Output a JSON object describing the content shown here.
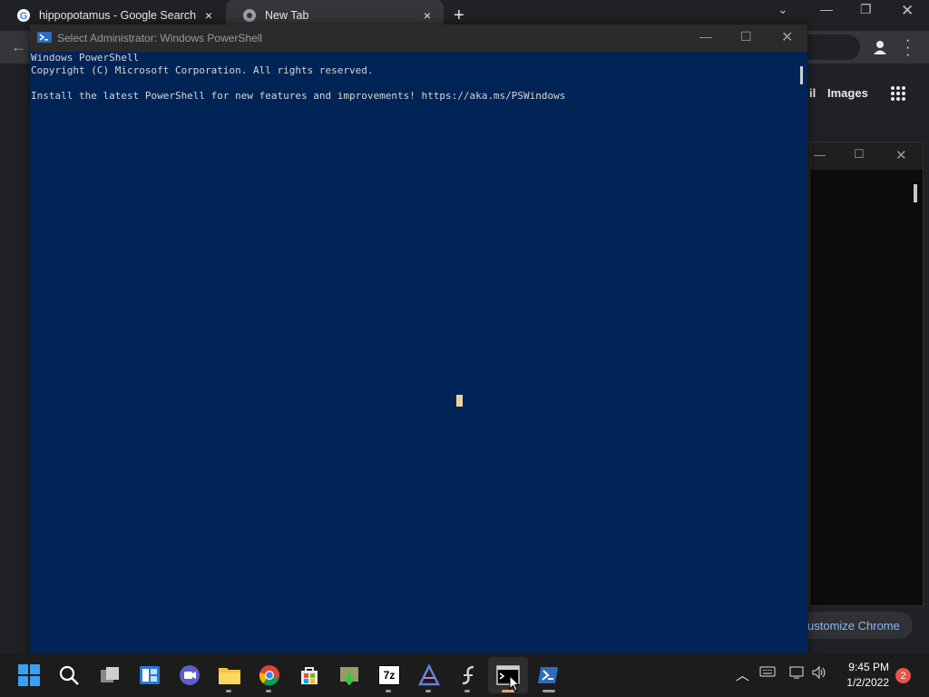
{
  "chrome": {
    "tabs": [
      {
        "title": "hippopotamus - Google Search"
      },
      {
        "title": "New Tab"
      }
    ],
    "new_tab_symbol": "+",
    "close_symbol": "×",
    "header_links": {
      "first_partial": "il",
      "images": "Images"
    },
    "customize_label": "ustomize Chrome"
  },
  "powershell": {
    "title": "Select Administrator: Windows PowerShell",
    "lines": [
      "Windows PowerShell",
      "Copyright (C) Microsoft Corporation. All rights reserved.",
      "",
      "Install the latest PowerShell for new features and improvements! https://aka.ms/PSWindows"
    ],
    "background": "#012456"
  },
  "taskbar": {
    "apps": [
      "start-icon",
      "search-icon",
      "task-view-icon",
      "widgets-icon",
      "chat-icon",
      "file-explorer-icon",
      "chrome-icon",
      "store-icon",
      "app-installer-icon",
      "sevenzip-icon",
      "vector-app-icon",
      "sigma-app-icon",
      "terminal-icon",
      "powershell-icon"
    ],
    "sevenzip_label": "7z",
    "clock_time": "9:45 PM",
    "clock_date": "1/2/2022",
    "notifications": "2"
  }
}
